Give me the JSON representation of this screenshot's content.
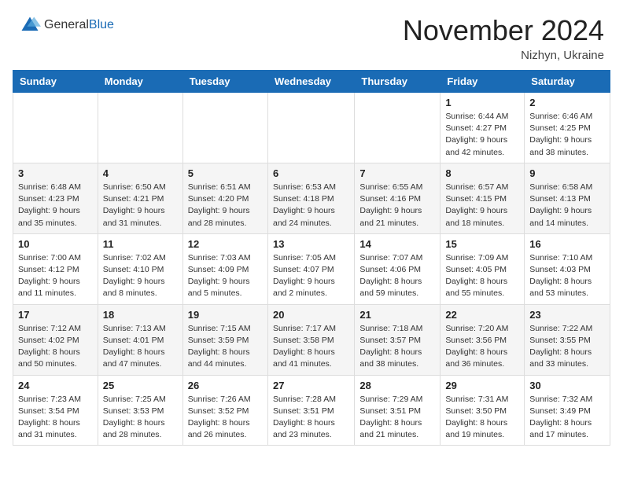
{
  "header": {
    "logo_general": "General",
    "logo_blue": "Blue",
    "month_title": "November 2024",
    "location": "Nizhyn, Ukraine"
  },
  "weekdays": [
    "Sunday",
    "Monday",
    "Tuesday",
    "Wednesday",
    "Thursday",
    "Friday",
    "Saturday"
  ],
  "weeks": [
    [
      {
        "day": "",
        "info": ""
      },
      {
        "day": "",
        "info": ""
      },
      {
        "day": "",
        "info": ""
      },
      {
        "day": "",
        "info": ""
      },
      {
        "day": "",
        "info": ""
      },
      {
        "day": "1",
        "info": "Sunrise: 6:44 AM\nSunset: 4:27 PM\nDaylight: 9 hours\nand 42 minutes."
      },
      {
        "day": "2",
        "info": "Sunrise: 6:46 AM\nSunset: 4:25 PM\nDaylight: 9 hours\nand 38 minutes."
      }
    ],
    [
      {
        "day": "3",
        "info": "Sunrise: 6:48 AM\nSunset: 4:23 PM\nDaylight: 9 hours\nand 35 minutes."
      },
      {
        "day": "4",
        "info": "Sunrise: 6:50 AM\nSunset: 4:21 PM\nDaylight: 9 hours\nand 31 minutes."
      },
      {
        "day": "5",
        "info": "Sunrise: 6:51 AM\nSunset: 4:20 PM\nDaylight: 9 hours\nand 28 minutes."
      },
      {
        "day": "6",
        "info": "Sunrise: 6:53 AM\nSunset: 4:18 PM\nDaylight: 9 hours\nand 24 minutes."
      },
      {
        "day": "7",
        "info": "Sunrise: 6:55 AM\nSunset: 4:16 PM\nDaylight: 9 hours\nand 21 minutes."
      },
      {
        "day": "8",
        "info": "Sunrise: 6:57 AM\nSunset: 4:15 PM\nDaylight: 9 hours\nand 18 minutes."
      },
      {
        "day": "9",
        "info": "Sunrise: 6:58 AM\nSunset: 4:13 PM\nDaylight: 9 hours\nand 14 minutes."
      }
    ],
    [
      {
        "day": "10",
        "info": "Sunrise: 7:00 AM\nSunset: 4:12 PM\nDaylight: 9 hours\nand 11 minutes."
      },
      {
        "day": "11",
        "info": "Sunrise: 7:02 AM\nSunset: 4:10 PM\nDaylight: 9 hours\nand 8 minutes."
      },
      {
        "day": "12",
        "info": "Sunrise: 7:03 AM\nSunset: 4:09 PM\nDaylight: 9 hours\nand 5 minutes."
      },
      {
        "day": "13",
        "info": "Sunrise: 7:05 AM\nSunset: 4:07 PM\nDaylight: 9 hours\nand 2 minutes."
      },
      {
        "day": "14",
        "info": "Sunrise: 7:07 AM\nSunset: 4:06 PM\nDaylight: 8 hours\nand 59 minutes."
      },
      {
        "day": "15",
        "info": "Sunrise: 7:09 AM\nSunset: 4:05 PM\nDaylight: 8 hours\nand 55 minutes."
      },
      {
        "day": "16",
        "info": "Sunrise: 7:10 AM\nSunset: 4:03 PM\nDaylight: 8 hours\nand 53 minutes."
      }
    ],
    [
      {
        "day": "17",
        "info": "Sunrise: 7:12 AM\nSunset: 4:02 PM\nDaylight: 8 hours\nand 50 minutes."
      },
      {
        "day": "18",
        "info": "Sunrise: 7:13 AM\nSunset: 4:01 PM\nDaylight: 8 hours\nand 47 minutes."
      },
      {
        "day": "19",
        "info": "Sunrise: 7:15 AM\nSunset: 3:59 PM\nDaylight: 8 hours\nand 44 minutes."
      },
      {
        "day": "20",
        "info": "Sunrise: 7:17 AM\nSunset: 3:58 PM\nDaylight: 8 hours\nand 41 minutes."
      },
      {
        "day": "21",
        "info": "Sunrise: 7:18 AM\nSunset: 3:57 PM\nDaylight: 8 hours\nand 38 minutes."
      },
      {
        "day": "22",
        "info": "Sunrise: 7:20 AM\nSunset: 3:56 PM\nDaylight: 8 hours\nand 36 minutes."
      },
      {
        "day": "23",
        "info": "Sunrise: 7:22 AM\nSunset: 3:55 PM\nDaylight: 8 hours\nand 33 minutes."
      }
    ],
    [
      {
        "day": "24",
        "info": "Sunrise: 7:23 AM\nSunset: 3:54 PM\nDaylight: 8 hours\nand 31 minutes."
      },
      {
        "day": "25",
        "info": "Sunrise: 7:25 AM\nSunset: 3:53 PM\nDaylight: 8 hours\nand 28 minutes."
      },
      {
        "day": "26",
        "info": "Sunrise: 7:26 AM\nSunset: 3:52 PM\nDaylight: 8 hours\nand 26 minutes."
      },
      {
        "day": "27",
        "info": "Sunrise: 7:28 AM\nSunset: 3:51 PM\nDaylight: 8 hours\nand 23 minutes."
      },
      {
        "day": "28",
        "info": "Sunrise: 7:29 AM\nSunset: 3:51 PM\nDaylight: 8 hours\nand 21 minutes."
      },
      {
        "day": "29",
        "info": "Sunrise: 7:31 AM\nSunset: 3:50 PM\nDaylight: 8 hours\nand 19 minutes."
      },
      {
        "day": "30",
        "info": "Sunrise: 7:32 AM\nSunset: 3:49 PM\nDaylight: 8 hours\nand 17 minutes."
      }
    ]
  ]
}
